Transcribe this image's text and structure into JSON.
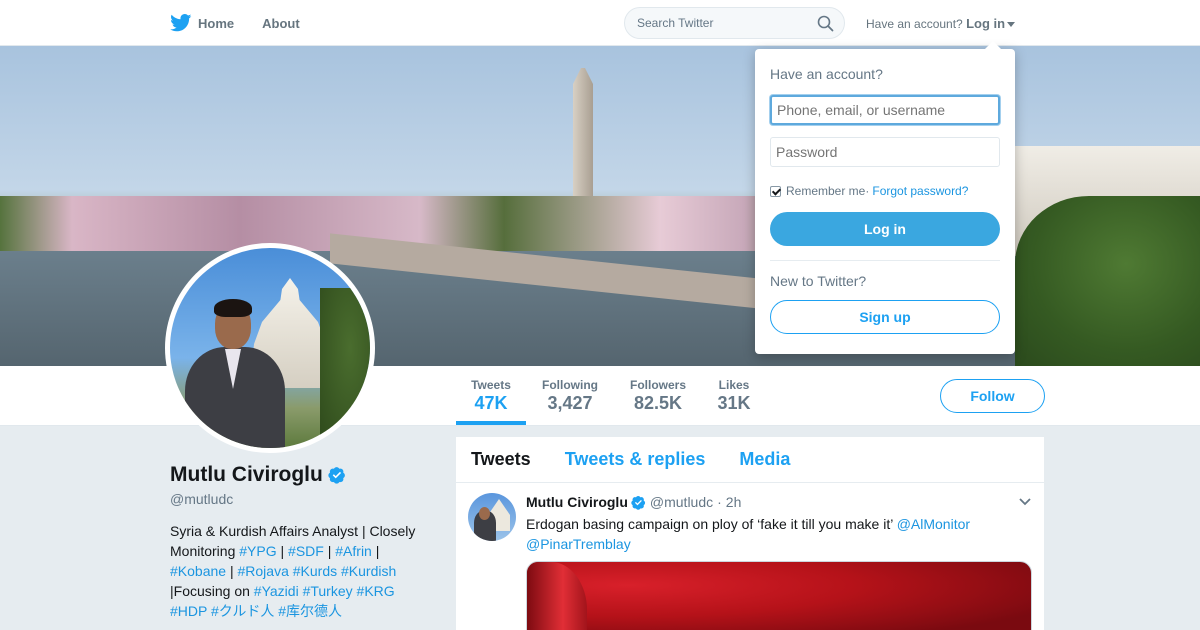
{
  "nav": {
    "home_label": "Home",
    "about_label": "About",
    "search_placeholder": "Search Twitter",
    "have_account": "Have an account?",
    "login_label": "Log in"
  },
  "profile": {
    "name": "Mutlu Civiroglu",
    "handle": "@mutludc",
    "bio": {
      "line1": "Syria & Kurdish Affairs Analyst | Closely",
      "line2_prefix": "Monitoring ",
      "tags_line2": [
        "#YPG",
        "#SDF",
        "#Afrin"
      ],
      "tags_line3": [
        "#Kobane",
        "#Rojava",
        "#Kurds",
        "#Kurdish"
      ],
      "line4_prefix": "|Focusing on ",
      "tags_line4": [
        "#Yazidi",
        "#Turkey",
        "#KRG"
      ],
      "tags_line5": [
        "#HDP",
        "#クルド人",
        "#库尔德人"
      ]
    }
  },
  "stats": [
    {
      "label": "Tweets",
      "value": "47K",
      "active": true
    },
    {
      "label": "Following",
      "value": "3,427"
    },
    {
      "label": "Followers",
      "value": "82.5K"
    },
    {
      "label": "Likes",
      "value": "31K"
    }
  ],
  "follow_label": "Follow",
  "tabs": [
    {
      "label": "Tweets",
      "active": true
    },
    {
      "label": "Tweets & replies"
    },
    {
      "label": "Media"
    }
  ],
  "tweet": {
    "name": "Mutlu Civiroglu",
    "handle": "@mutludc",
    "separator": "·",
    "time": "2h",
    "text": "Erdogan basing campaign on ploy of ‘fake it till you make it’ ",
    "mention1": "@AlMonitor",
    "mention2": "@PinarTremblay"
  },
  "login_dropdown": {
    "title": "Have an account?",
    "username_placeholder": "Phone, email, or username",
    "password_placeholder": "Password",
    "remember_label": "Remember me",
    "separator": " · ",
    "forgot_label": "Forgot password?",
    "login_button": "Log in",
    "new_label": "New to Twitter?",
    "signup_button": "Sign up"
  },
  "colors": {
    "accent": "#1da1f2",
    "link": "#1b95e0",
    "background": "#e6ecf0"
  },
  "icons": [
    "twitter-bird-icon",
    "search-icon",
    "verified-badge-icon",
    "chevron-down-icon",
    "caret-down-icon"
  ]
}
